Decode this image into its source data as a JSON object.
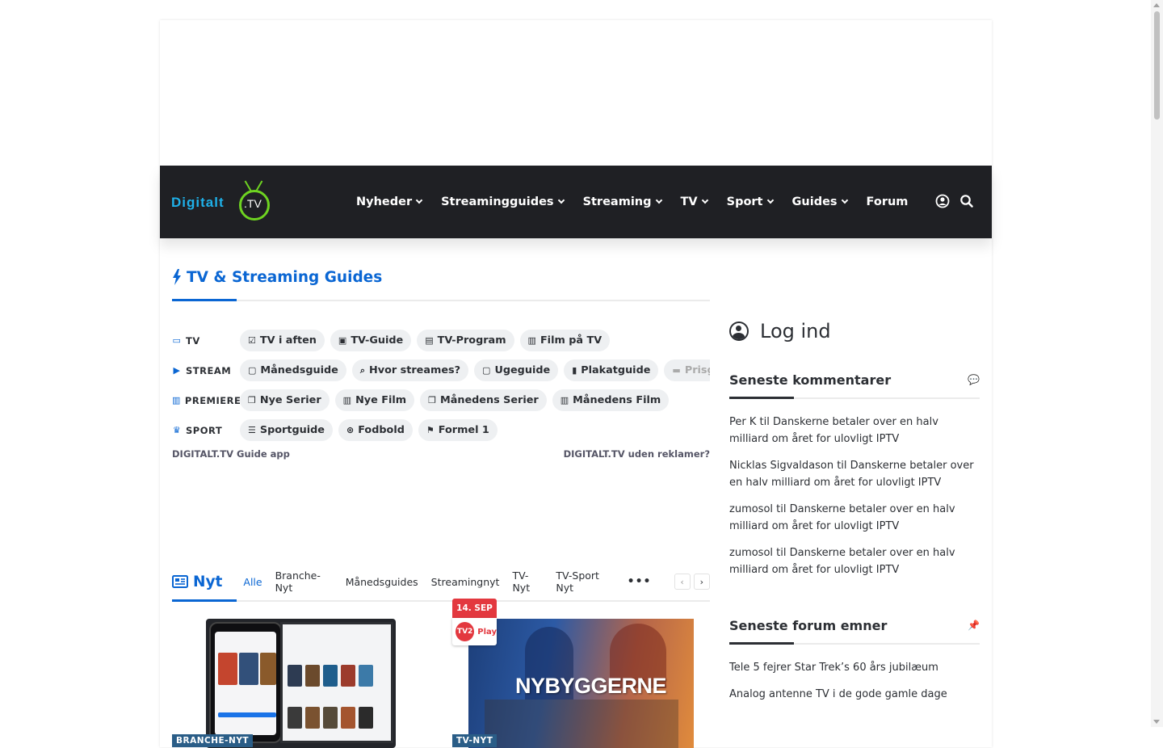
{
  "logo": {
    "word": "Digitalt",
    "tv": ".TV"
  },
  "nav": {
    "items": [
      {
        "label": "Nyheder",
        "dropdown": true
      },
      {
        "label": "Streamingguides",
        "dropdown": true
      },
      {
        "label": "Streaming",
        "dropdown": true
      },
      {
        "label": "TV",
        "dropdown": true
      },
      {
        "label": "Sport",
        "dropdown": true
      },
      {
        "label": "Guides",
        "dropdown": true
      },
      {
        "label": "Forum",
        "dropdown": false
      }
    ],
    "icons": [
      "user-icon",
      "search-icon"
    ]
  },
  "guides": {
    "title": "TV & Streaming Guides",
    "rows": [
      {
        "label": "TV",
        "icon": "monitor-icon",
        "pills": [
          {
            "label": "TV i aften",
            "icon": "calendar-check-icon"
          },
          {
            "label": "TV-Guide",
            "icon": "book-reader-icon"
          },
          {
            "label": "TV-Program",
            "icon": "list-alt-icon"
          },
          {
            "label": "Film på TV",
            "icon": "film-icon"
          }
        ]
      },
      {
        "label": "STREAM",
        "icon": "play-circle-icon",
        "pills": [
          {
            "label": "Månedsguide",
            "icon": "calendar-icon"
          },
          {
            "label": "Hvor streames?",
            "icon": "search-icon"
          },
          {
            "label": "Ugeguide",
            "icon": "calendar-icon"
          },
          {
            "label": "Plakatguide",
            "icon": "file-image-icon"
          },
          {
            "label": "Prisguide",
            "icon": "money-bill-icon"
          }
        ]
      },
      {
        "label": "PREMIERER",
        "icon": "film-icon",
        "pills": [
          {
            "label": "Nye Serier",
            "icon": "clone-icon"
          },
          {
            "label": "Nye Film",
            "icon": "film-icon"
          },
          {
            "label": "Månedens Serier",
            "icon": "clone-icon"
          },
          {
            "label": "Månedens Film",
            "icon": "film-icon"
          }
        ]
      },
      {
        "label": "SPORT",
        "icon": "trophy-icon",
        "pills": [
          {
            "label": "Sportguide",
            "icon": "list-icon"
          },
          {
            "label": "Fodbold",
            "icon": "futbol-icon"
          },
          {
            "label": "Formel 1",
            "icon": "flag-checkered-icon"
          }
        ]
      }
    ],
    "footer_left": "DIGITALT.TV Guide app",
    "footer_right": "DIGITALT.TV uden reklamer?"
  },
  "news": {
    "title": "Nyt",
    "tabs": [
      "Alle",
      "Branche-Nyt",
      "Månedsguides",
      "Streamingnyt",
      "TV-Nyt",
      "TV-Sport Nyt"
    ],
    "more": "•••",
    "cards": [
      {
        "category": "BRANCHE-NYT"
      },
      {
        "category": "TV-NYT",
        "date": "14. SEP",
        "channel_logo": "TV2",
        "channel_play": "Play",
        "image_text": "NYBYGGERNE"
      }
    ]
  },
  "sidebar": {
    "login": "Log ind",
    "comments_title": "Seneste kommentarer",
    "comments": [
      "Per K til Danskerne betaler over en halv milliard om året for ulovligt IPTV",
      "Nicklas Sigvaldason til Danskerne betaler over en halv milliard om året for ulovligt IPTV",
      "zumosol til Danskerne betaler over en halv milliard om året for ulovligt IPTV",
      "zumosol til Danskerne betaler over en halv milliard om året for ulovligt IPTV"
    ],
    "forum_title": "Seneste forum emner",
    "forum": [
      "Tele 5 fejrer Star Trek’s 60 års jubilæum",
      "Analog antenne TV i de gode gamle dage"
    ]
  },
  "colors": {
    "accent": "#0a66d3",
    "header_bg": "#1f2024",
    "logo_green": "#6ed321",
    "logo_blue": "#1fb0e8",
    "badge": "#2a5d87",
    "date_red": "#e3383f"
  }
}
